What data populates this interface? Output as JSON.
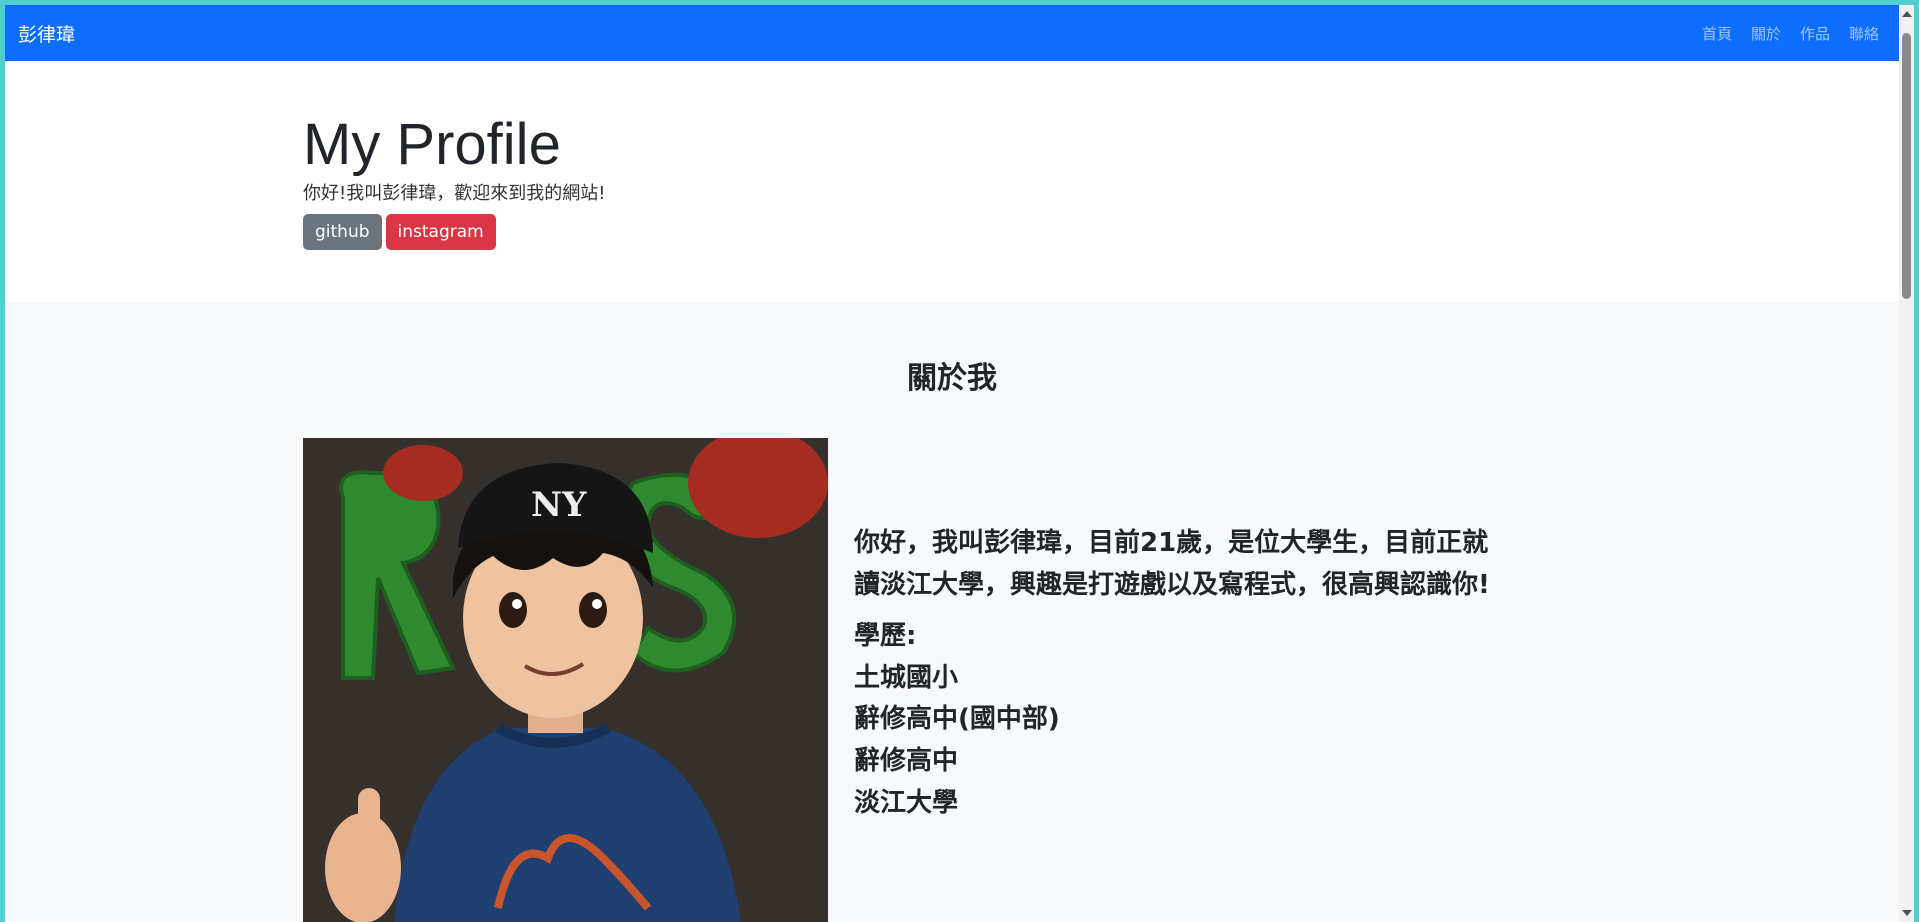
{
  "navbar": {
    "brand": "彭律瑋",
    "links": [
      "首頁",
      "關於",
      "作品",
      "聯絡"
    ]
  },
  "hero": {
    "title": "My Profile",
    "subtitle": "你好!我叫彭律瑋，歡迎來到我的網站!",
    "buttons": {
      "github": "github",
      "instagram": "instagram"
    }
  },
  "about": {
    "title": "關於我",
    "intro": "你好，我叫彭律瑋，目前21歲，是位大學生，目前正就讀淡江大學，興趣是打遊戲以及寫程式，很高興認識你!",
    "education_label": "學歷:",
    "education": [
      "土城國小",
      "辭修高中(國中部)",
      "辭修高中",
      "淡江大學"
    ]
  },
  "colors": {
    "navbar": "#0d6efd",
    "github_button": "#6c757d",
    "instagram_button": "#dc3545",
    "section_bg": "#f8f9fa"
  }
}
